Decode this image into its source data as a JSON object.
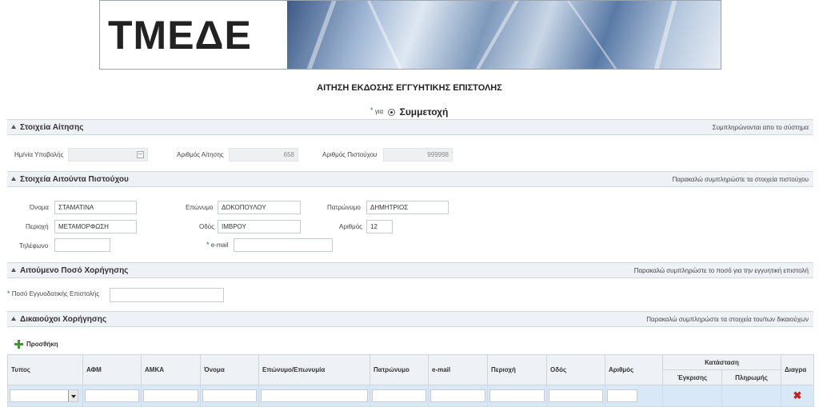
{
  "banner": {
    "logo_text": "TMEΔE"
  },
  "page_title": "ΑΙΤΗΣΗ ΕΚΔΟΣΗΣ ΕΓΓΥΗΤΙΚΗΣ ΕΠΙΣΤΟΛΗΣ",
  "purpose": {
    "label": "για",
    "selected_option": "Συμμετοχή"
  },
  "sections": {
    "application": {
      "title": "Στοιχεία Αίτησης",
      "note": "Συμπληρώνονται απο το σύστημα",
      "submission_date_label": "Ημ/νία Υποβολής",
      "submission_date_value": "",
      "application_number_label": "Αριθμός Αίτησης",
      "application_number_value": "658",
      "credit_number_label": "Αριθμός Πιστούχου",
      "credit_number_value": "999998"
    },
    "applicant": {
      "title": "Στοιχεία Αιτούντα Πιστούχου",
      "note": "Παρακαλώ συμπληρώστε τα στοιχεία πιστούχου",
      "first_name_label": "Όνομα",
      "first_name_value": "ΣΤΑΜΑΤΙΝΑ",
      "last_name_label": "Επώνυμο",
      "last_name_value": "ΔΟΚΟΠΟΥΛΟΥ",
      "father_name_label": "Πατρώνυμο",
      "father_name_value": "ΔΗΜΗΤΡΙΟΣ",
      "area_label": "Περιοχή",
      "area_value": "ΜΕΤΑΜΟΡΦΩΣΗ",
      "street_label": "Οδός",
      "street_value": "ΙΜΒΡΟΥ",
      "number_label": "Αριθμός",
      "number_value": "12",
      "phone_label": "Τηλέφωνο",
      "phone_value": "",
      "email_label": "e-mail",
      "email_value": ""
    },
    "amount": {
      "title": "Αιτούμενο Ποσό Χορήγησης",
      "note": "Παρακαλώ συμπληρώστε το ποσό για την εγγυητική επιστολή",
      "amount_label": "Ποσό Εγγυοδοτικής Επιστολής",
      "amount_value": ""
    },
    "beneficiaries": {
      "title": "Δικαιούχοι Χορήγησης",
      "note": "Παρακαλώ συμπληρώστε τα στοιχεία του/των δικαιούχων",
      "add_label": "Προσθήκη",
      "columns": [
        "Τυπος",
        "ΑΦΜ",
        "ΑΜΚΑ",
        "Όνομα",
        "Επώνυμο/Επωνυμία",
        "Πατρώνυμο",
        "e-mail",
        "Περιοχή",
        "Οδός",
        "Αριθμός"
      ],
      "status_group": "Κατάσταση",
      "status_columns": [
        "Έγκρισης",
        "Πληρωμής"
      ],
      "delete_column": "Διαγρα"
    }
  },
  "colors": {
    "required_marker": "#2b5fb3",
    "delete": "#c0221f",
    "add": "#3a9a2a",
    "row_bg": "#d9e8f7"
  }
}
